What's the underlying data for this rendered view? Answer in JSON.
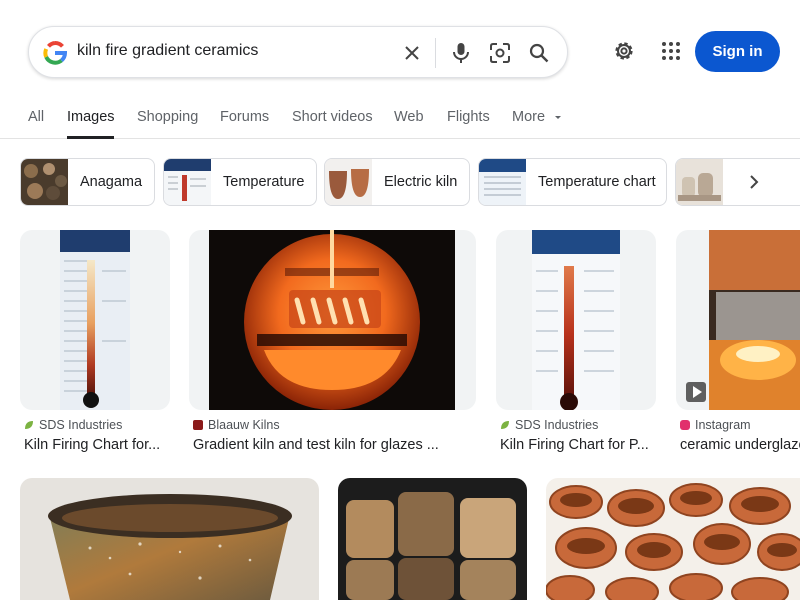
{
  "search": {
    "query": "kiln fire gradient ceramics",
    "clear_icon": "close-icon",
    "voice_icon": "microphone-icon",
    "lens_icon": "camera-lens-icon",
    "search_icon": "search-icon"
  },
  "header": {
    "signin_label": "Sign in",
    "settings_icon": "gear-icon",
    "apps_icon": "apps-grid-icon",
    "brand_colors": {
      "blue": "#4285f4",
      "red": "#ea4335",
      "yellow": "#fbbc05",
      "green": "#34a853",
      "signin_bg": "#0b57d0"
    }
  },
  "tabs": [
    {
      "label": "All"
    },
    {
      "label": "Images"
    },
    {
      "label": "Shopping"
    },
    {
      "label": "Forums"
    },
    {
      "label": "Short videos"
    },
    {
      "label": "Web"
    },
    {
      "label": "Flights"
    },
    {
      "label": "More"
    }
  ],
  "chips": [
    {
      "label": "Anagama"
    },
    {
      "label": "Temperature"
    },
    {
      "label": "Electric kiln"
    },
    {
      "label": "Temperature chart"
    },
    {
      "label": ""
    }
  ],
  "results": [
    {
      "source": "SDS Industries",
      "title": "Kiln Firing Chart for..."
    },
    {
      "source": "Blaauw Kilns",
      "title": "Gradient kiln and test kiln for glazes ..."
    },
    {
      "source": "SDS Industries",
      "title": "Kiln Firing Chart for P..."
    },
    {
      "source": "Instagram",
      "title": "ceramic underglaze"
    }
  ]
}
